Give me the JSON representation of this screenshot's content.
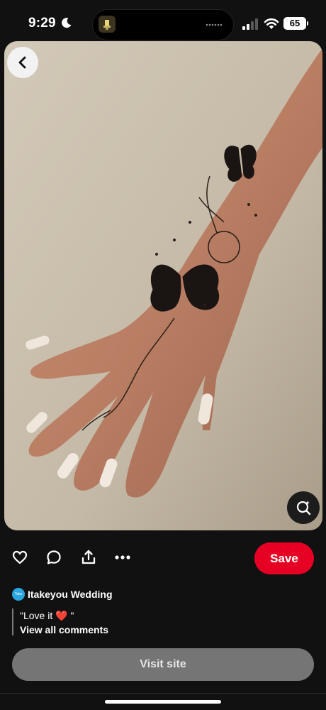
{
  "status_bar": {
    "time": "9:29",
    "battery": "65"
  },
  "pin": {
    "source_name": "Itakeyou Wedding",
    "source_avatar_text": "Take you",
    "comment": "\"Love it ❤️ \"",
    "view_comments_label": "View all comments"
  },
  "actions": {
    "save_label": "Save",
    "visit_label": "Visit site"
  },
  "colors": {
    "save": "#e60023",
    "background": "#111111",
    "visit": "#757575"
  }
}
